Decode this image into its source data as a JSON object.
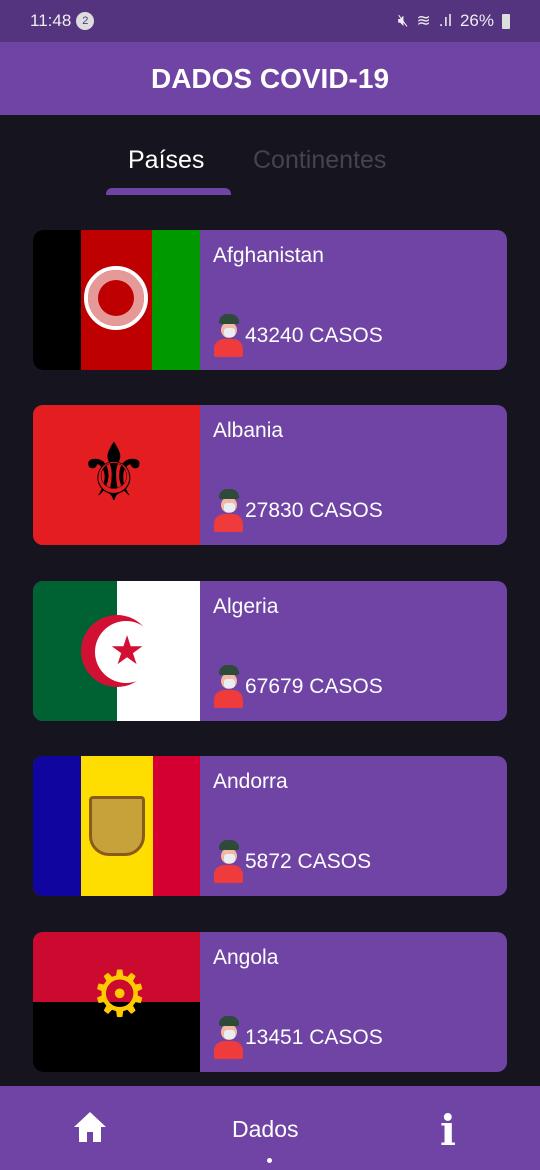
{
  "status": {
    "time": "11:48",
    "notif_count": "2",
    "battery": "26%"
  },
  "appbar": {
    "title": "DADOS COVID-19"
  },
  "tabs": [
    {
      "label": "Países",
      "active": true
    },
    {
      "label": "Continentes",
      "active": false
    }
  ],
  "countries": [
    {
      "name": "Afghanistan",
      "cases": "43240 CASOS",
      "flag": [
        "#000000",
        "#be0000",
        "#009900"
      ]
    },
    {
      "name": "Albania",
      "cases": "27830 CASOS",
      "flag": [
        "#e41e20"
      ]
    },
    {
      "name": "Algeria",
      "cases": "67679 CASOS",
      "flag": [
        "#006233",
        "#ffffff"
      ]
    },
    {
      "name": "Andorra",
      "cases": "5872 CASOS",
      "flag": [
        "#10069f",
        "#fedd00",
        "#d50032"
      ]
    },
    {
      "name": "Angola",
      "cases": "13451 CASOS",
      "flag": [
        "#cc092f",
        "#000000"
      ]
    }
  ],
  "bottom_nav": {
    "home_icon": "home-icon",
    "center_label": "Dados",
    "info_icon": "info-icon"
  },
  "colors": {
    "primary": "#6f44a4",
    "background": "#16151f",
    "status": "#54337f"
  }
}
